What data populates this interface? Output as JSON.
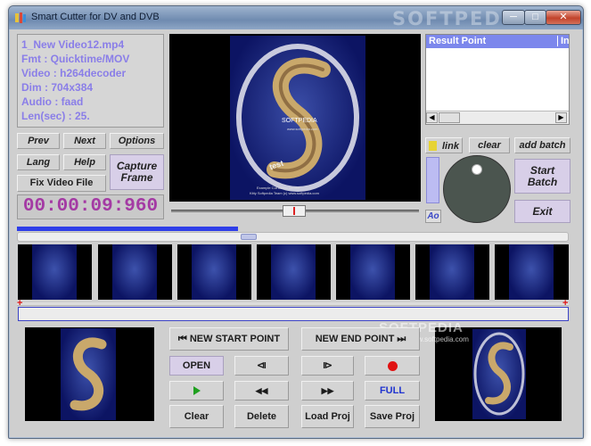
{
  "window": {
    "title": "Smart Cutter for DV and DVB",
    "watermark": "SOFTPEDIA",
    "min_glyph": "─",
    "max_glyph": "□",
    "close_glyph": "✕"
  },
  "info": {
    "file": "1_New Video12.mp4",
    "fmt": "Fmt : Quicktime/MOV",
    "video": "Video : h264decoder",
    "dim": "Dim : 704x384",
    "audio": "Audio : faad",
    "len": "Len(sec) : 25."
  },
  "nav": {
    "prev": "Prev",
    "next": "Next",
    "options": "Options",
    "lang": "Lang",
    "help": "Help",
    "capture_frame": "Capture Frame",
    "fix_video_file": "Fix Video File"
  },
  "timecode": "00:00:09:960",
  "result_list": {
    "col_result": "Result Point",
    "col_in": "In",
    "scroll_left": "◀",
    "scroll_right": "▶"
  },
  "batch": {
    "link": "link",
    "clear": "clear",
    "add_batch": "add batch",
    "start_batch": "Start Batch",
    "exit": "Exit",
    "ao": "Ao"
  },
  "progress": {
    "value_fraction": 0.4
  },
  "markers": {
    "start": "+",
    "end": "+"
  },
  "controls": {
    "new_start_point": "NEW START POINT",
    "new_end_point": "NEW END POINT",
    "open": "OPEN",
    "full": "FULL",
    "clear": "Clear",
    "delete": "Delete",
    "load_proj": "Load Proj",
    "save_proj": "Save Proj",
    "icons": {
      "step_back_frame": "⧏",
      "step_forward_frame": "⧐",
      "rewind": "◀◀",
      "fast_forward": "▶▶",
      "goto_start": "⏮",
      "goto_end": "⏭"
    }
  },
  "video": {
    "overlay_title": "SOFTPEDIA",
    "overlay_url": "www.softpedia.com",
    "overlay_word": "test",
    "caption_1": "Example Cut Demo Vendor",
    "caption_2": "Kitty Softpedia Team (c) www.softpedia.com",
    "watermark_sub": "www.softpedia.com"
  },
  "colors": {
    "accent_purple": "#8a7ee8",
    "timecode": "#a43aa4",
    "progress_blue": "#2f3ee8",
    "header_blue": "#7c87ec",
    "record_red": "#e01212",
    "play_green": "#20a020"
  }
}
